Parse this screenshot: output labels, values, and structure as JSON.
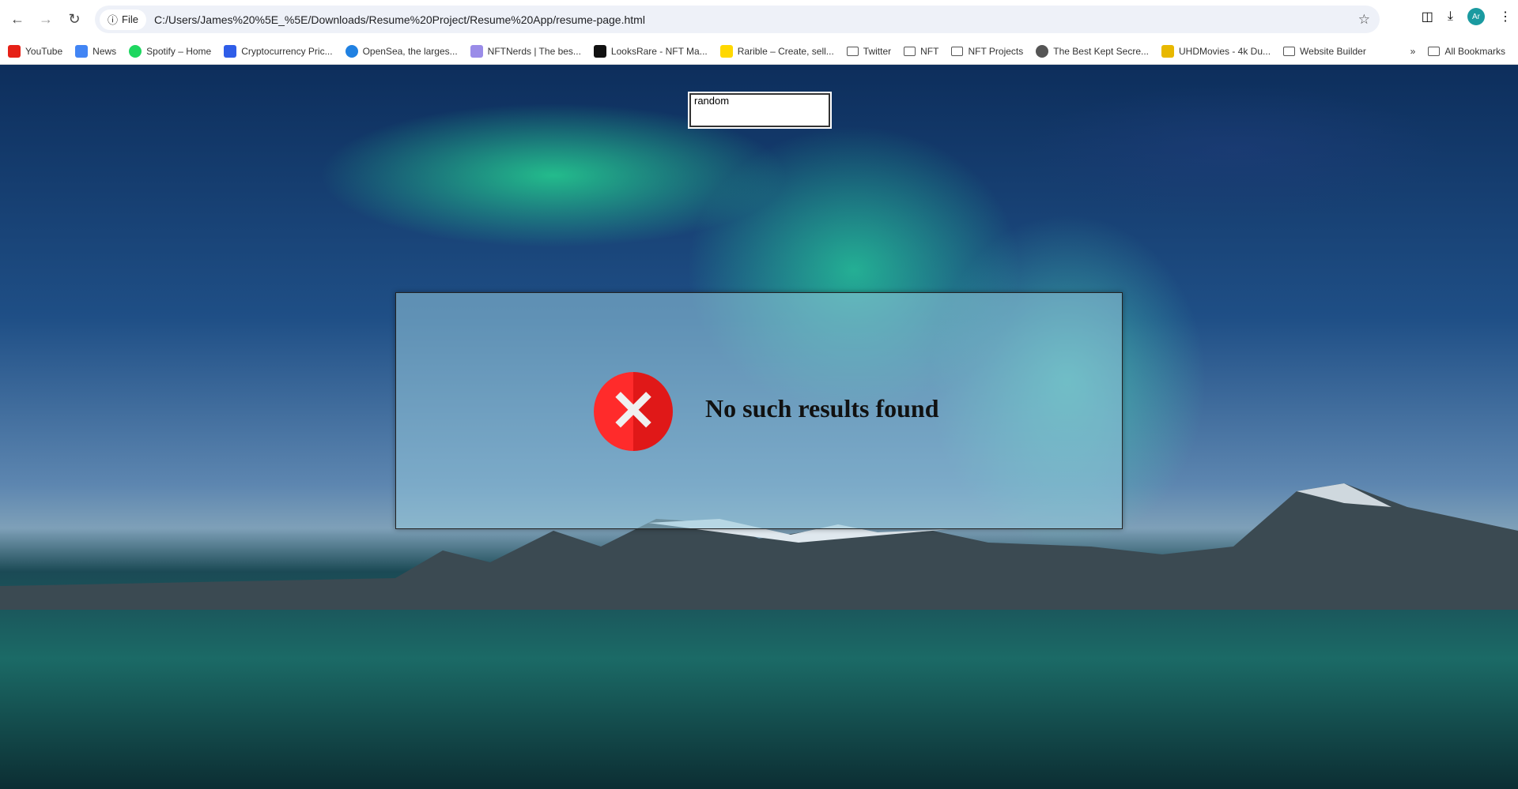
{
  "browser": {
    "url": "C:/Users/James%20%5E_%5E/Downloads/Resume%20Project/Resume%20App/resume-page.html",
    "scheme_label": "File",
    "profile_initials": "Ar"
  },
  "bookmarks": [
    {
      "label": "YouTube",
      "icon": "youtube-icon",
      "color": "#e62117"
    },
    {
      "label": "News",
      "icon": "news-icon",
      "color": "#4285f4"
    },
    {
      "label": "Spotify – Home",
      "icon": "spotify-icon",
      "color": "#1ed760"
    },
    {
      "label": "Cryptocurrency Pric...",
      "icon": "coinmarketcap-icon",
      "color": "#2f5de8"
    },
    {
      "label": "OpenSea, the larges...",
      "icon": "opensea-icon",
      "color": "#2081e2"
    },
    {
      "label": "NFTNerds | The bes...",
      "icon": "nftnerds-icon",
      "color": "#9a8ce8"
    },
    {
      "label": "LooksRare - NFT Ma...",
      "icon": "looksrare-icon",
      "color": "#111111"
    },
    {
      "label": "Rarible – Create, sell...",
      "icon": "rarible-icon",
      "color": "#ffd800"
    },
    {
      "label": "Twitter",
      "icon": "folder-icon"
    },
    {
      "label": "NFT",
      "icon": "folder-icon"
    },
    {
      "label": "NFT Projects",
      "icon": "folder-icon"
    },
    {
      "label": "The Best Kept Secre...",
      "icon": "globe-icon",
      "color": "#555555"
    },
    {
      "label": "UHDMovies - 4k Du...",
      "icon": "uhdmovies-icon",
      "color": "#e8b800"
    },
    {
      "label": "Website Builder",
      "icon": "folder-icon"
    }
  ],
  "all_bookmarks_label": "All Bookmarks",
  "search": {
    "value": "random"
  },
  "result": {
    "message": "No such results found",
    "icon": "error-x-icon",
    "icon_color": "#ff2b2b"
  }
}
